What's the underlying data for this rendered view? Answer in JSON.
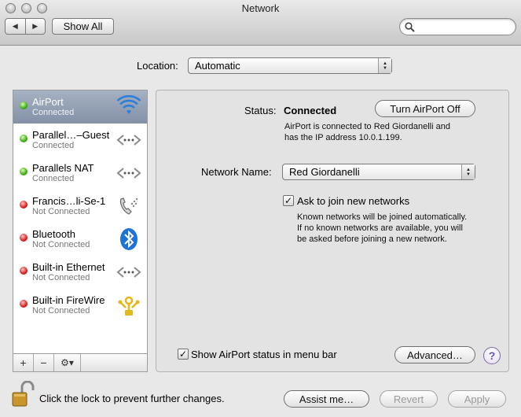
{
  "window": {
    "title": "Network"
  },
  "toolbar": {
    "show_all": "Show All",
    "search_placeholder": ""
  },
  "location": {
    "label": "Location:",
    "value": "Automatic"
  },
  "services": [
    {
      "name": "AirPort",
      "status": "Connected",
      "state": "green",
      "icon": "wifi-icon",
      "selected": true
    },
    {
      "name": "Parallel…–Guest",
      "status": "Connected",
      "state": "green",
      "icon": "ethernet-arrows-icon"
    },
    {
      "name": "Parallels NAT",
      "status": "Connected",
      "state": "green",
      "icon": "ethernet-arrows-icon"
    },
    {
      "name": "Francis…li-Se-1",
      "status": "Not Connected",
      "state": "red",
      "icon": "phone-icon"
    },
    {
      "name": "Bluetooth",
      "status": "Not Connected",
      "state": "red",
      "icon": "bluetooth-icon"
    },
    {
      "name": "Built-in Ethernet",
      "status": "Not Connected",
      "state": "red",
      "icon": "ethernet-arrows-icon"
    },
    {
      "name": "Built-in FireWire",
      "status": "Not Connected",
      "state": "red",
      "icon": "firewire-icon"
    }
  ],
  "sidebar_bar": {
    "add": "+",
    "remove": "−",
    "gear": "⚙︎▾"
  },
  "detail": {
    "status_label": "Status:",
    "status_value": "Connected",
    "turn_off_button": "Turn AirPort Off",
    "status_desc_line1": "AirPort is connected to Red Giordanelli and",
    "status_desc_line2": "has the IP address 10.0.1.199.",
    "network_name_label": "Network Name:",
    "network_name_value": "Red Giordanelli",
    "ask_join_label": "Ask to join new networks",
    "ask_join_checked": true,
    "ask_desc_line1": "Known networks will be joined automatically.",
    "ask_desc_line2": "If no known networks are available, you will",
    "ask_desc_line3": "be asked before joining a new network.",
    "show_status_label": "Show AirPort status in menu bar",
    "show_status_checked": true,
    "advanced_button": "Advanced…",
    "help": "?"
  },
  "footer": {
    "lock_text": "Click the lock to prevent further changes.",
    "assist_button": "Assist me…",
    "revert_button": "Revert",
    "apply_button": "Apply"
  },
  "colors": {
    "wifi": "#2f7fd8",
    "bluetooth": "#1e73d6",
    "firewire": "#e2b81c",
    "selected": "#8d99ad"
  }
}
